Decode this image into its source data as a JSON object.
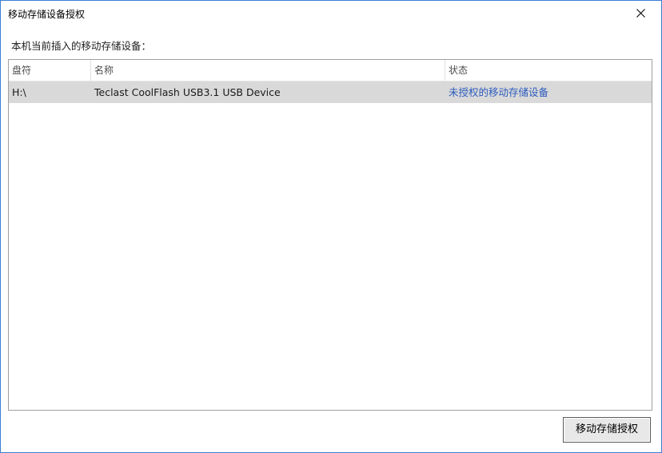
{
  "window": {
    "title": "移动存储设备授权"
  },
  "prompt": "本机当前插入的移动存储设备：",
  "table": {
    "columns": [
      "盘符",
      "名称",
      "状态"
    ],
    "rows": [
      {
        "drive": "H:\\",
        "name": "Teclast CoolFlash USB3.1 USB Device",
        "status": "未授权的移动存储设备"
      }
    ]
  },
  "actions": {
    "authorize_label": "移动存储授权"
  },
  "colors": {
    "window_border": "#3b7fd1",
    "selected_row": "#d9d9d9",
    "status_link": "#2c5bbd"
  },
  "icons": {
    "close": "close-icon"
  }
}
